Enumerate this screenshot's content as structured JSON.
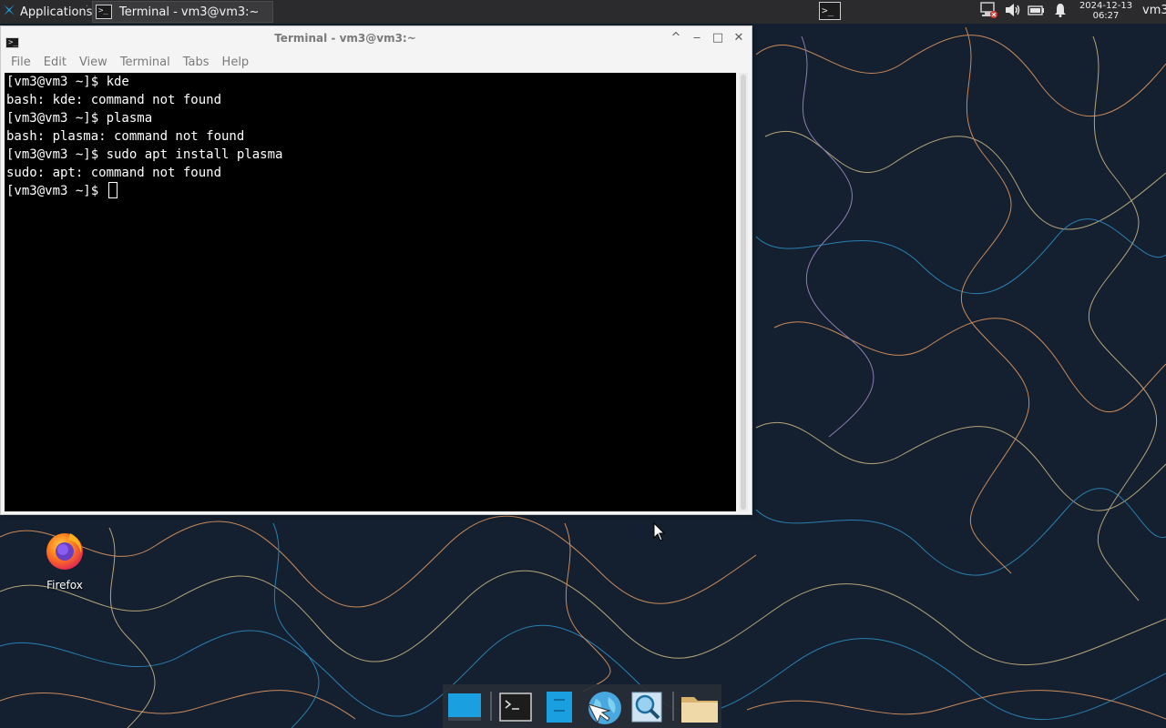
{
  "panel": {
    "applications_label": "Applications",
    "task_title": "Terminal - vm3@vm3:~",
    "date": "2024-12-13",
    "time": "06:27",
    "user": "vm3",
    "icons": {
      "apps": "xfce-mouse-icon",
      "task": "terminal-icon",
      "network": "network-disconnected-icon",
      "volume": "volume-icon",
      "battery": "battery-icon",
      "notifications": "bell-icon"
    }
  },
  "window": {
    "title": "Terminal - vm3@vm3:~",
    "menu": [
      "File",
      "Edit",
      "View",
      "Terminal",
      "Tabs",
      "Help"
    ],
    "controls": {
      "shade": "^",
      "minimize": "‒",
      "maximize": "□",
      "close": "✕"
    }
  },
  "terminal": {
    "lines": [
      "[vm3@vm3 ~]$ kde",
      "bash: kde: command not found",
      "[vm3@vm3 ~]$ plasma",
      "bash: plasma: command not found",
      "[vm3@vm3 ~]$ sudo apt install plasma",
      "sudo: apt: command not found",
      "[vm3@vm3 ~]$ "
    ]
  },
  "desktop": {
    "icons": [
      {
        "label": "Firefox",
        "icon": "firefox-icon"
      }
    ]
  },
  "dock": {
    "items": [
      {
        "name": "show-desktop",
        "icon": "desktop-icon"
      },
      {
        "name": "terminal",
        "icon": "terminal-icon"
      },
      {
        "name": "file-manager",
        "icon": "file-manager-icon"
      },
      {
        "name": "web-browser",
        "icon": "web-browser-icon"
      },
      {
        "name": "app-finder",
        "icon": "search-icon"
      },
      {
        "name": "folder",
        "icon": "folder-icon"
      }
    ]
  },
  "colors": {
    "desktop_bg": "#14202f",
    "panel_bg": "#2b2b2d",
    "terminal_bg": "#000000",
    "terminal_fg": "#ffffff",
    "accent_blue": "#1aa0e0"
  }
}
